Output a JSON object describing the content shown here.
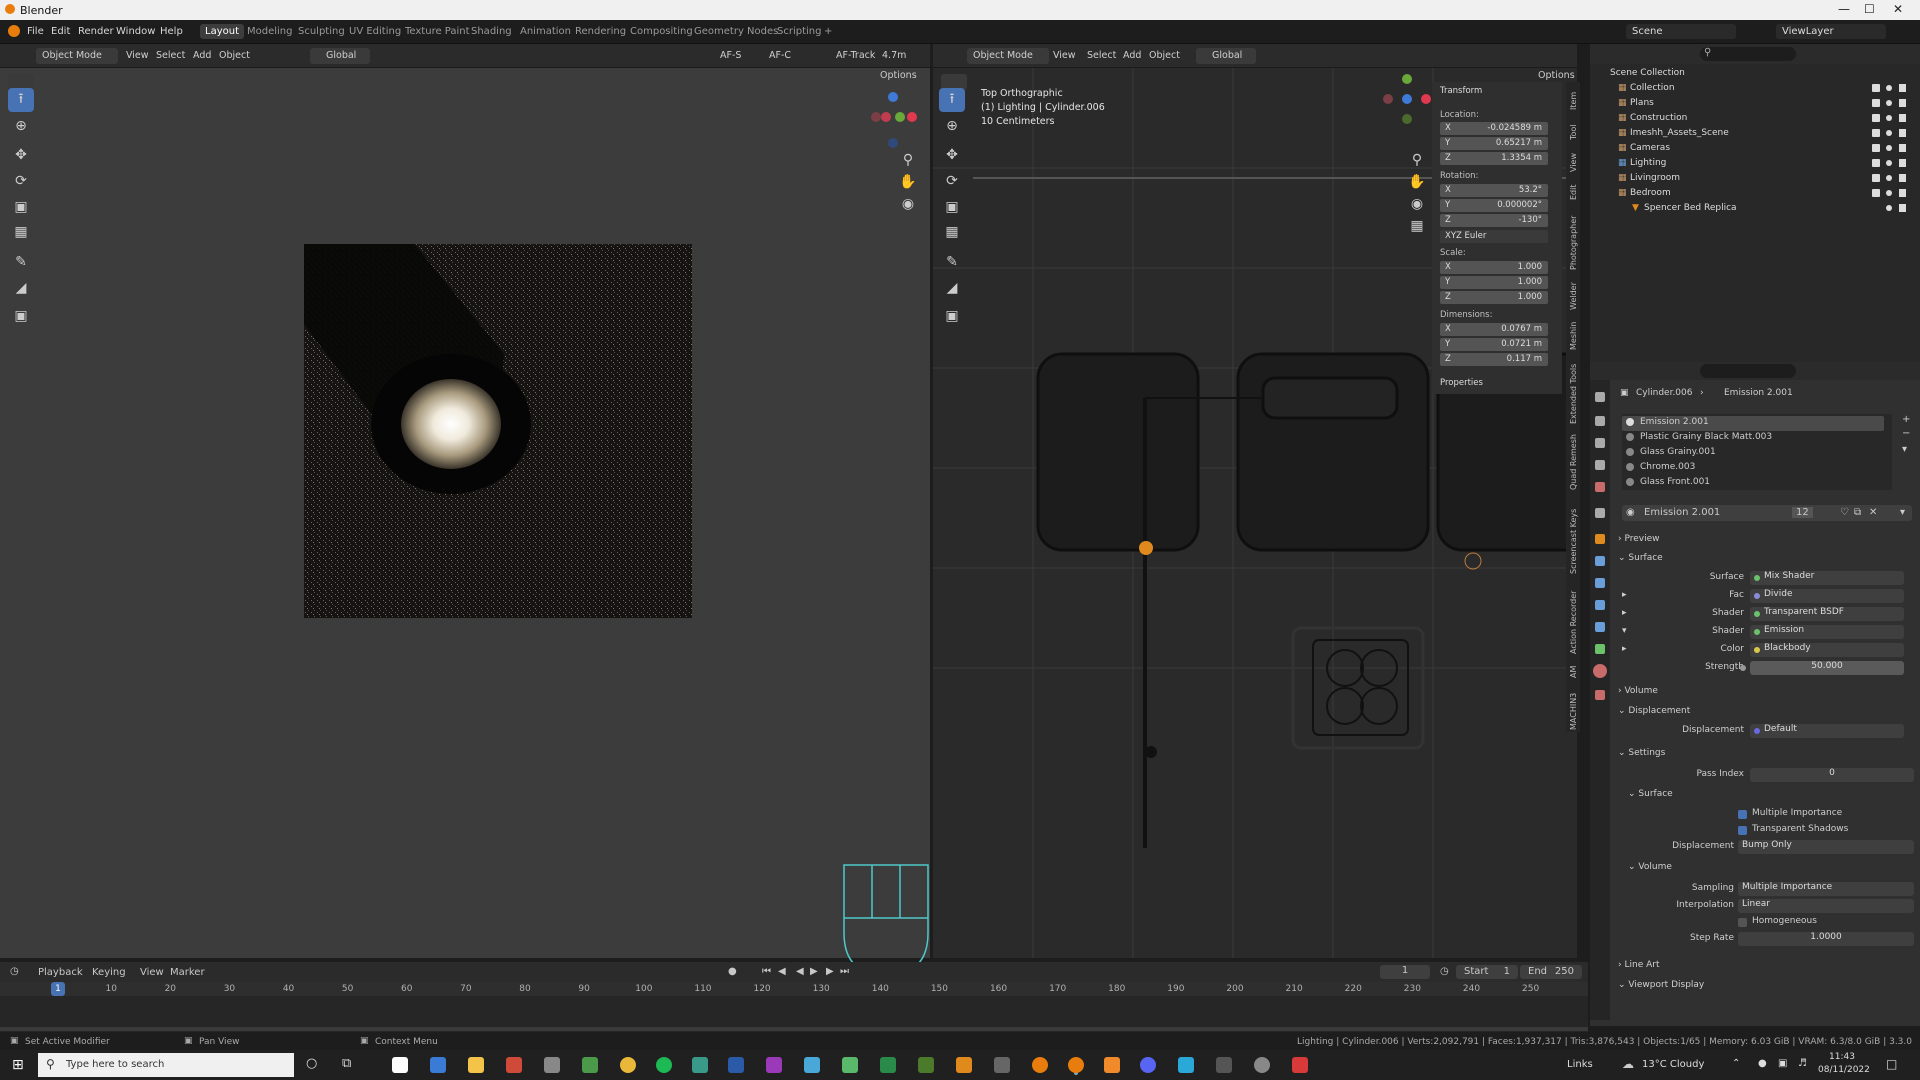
{
  "window": {
    "title": "Blender"
  },
  "menu": [
    "File",
    "Edit",
    "Render",
    "Window",
    "Help"
  ],
  "workspaces": [
    "Layout",
    "Modeling",
    "Sculpting",
    "UV Editing",
    "Texture Paint",
    "Shading",
    "Animation",
    "Rendering",
    "Compositing",
    "Geometry Nodes",
    "Scripting",
    "+"
  ],
  "scene": {
    "label": "Scene",
    "viewlayer": "ViewLayer"
  },
  "left_header": {
    "mode": "Object Mode",
    "items": [
      "View",
      "Select",
      "Add",
      "Object"
    ],
    "orientation": "Global",
    "af_s": "AF-S",
    "af_c": "AF-C",
    "af_track": "AF-Track",
    "focal": "4.7m",
    "options": "Options"
  },
  "right_header": {
    "mode": "Object Mode",
    "items": [
      "View",
      "Select",
      "Add",
      "Object"
    ],
    "orientation": "Global",
    "options": "Options"
  },
  "viewport_overlay": {
    "line1": "Top Orthographic",
    "line2": "(1) Lighting | Cylinder.006",
    "line3": "10 Centimeters"
  },
  "transform": {
    "title": "Transform",
    "location_label": "Location:",
    "location": {
      "x": "-0.024589 m",
      "y": "0.65217 m",
      "z": "1.3354 m"
    },
    "rotation_label": "Rotation:",
    "rotation": {
      "x": "53.2°",
      "y": "0.000002°",
      "z": "-130°"
    },
    "euler": "XYZ Euler",
    "scale_label": "Scale:",
    "scale": {
      "x": "1.000",
      "y": "1.000",
      "z": "1.000"
    },
    "dimensions_label": "Dimensions:",
    "dimensions": {
      "x": "0.0767 m",
      "y": "0.0721 m",
      "z": "0.117 m"
    },
    "properties": "Properties"
  },
  "npanel_tabs": [
    "Item",
    "Tool",
    "View",
    "Edit",
    "Photographer",
    "Welder",
    "Meshin",
    "Extended Tools",
    "Quad Remesh",
    "Screencast Keys",
    "Action Recorder",
    "AM",
    "MACHIN3"
  ],
  "outliner": {
    "root": "Scene Collection",
    "items": [
      {
        "name": "Collection",
        "indent": 1
      },
      {
        "name": "Plans",
        "indent": 1
      },
      {
        "name": "Construction",
        "indent": 1
      },
      {
        "name": "Imeshh_Assets_Scene",
        "indent": 1
      },
      {
        "name": "Cameras",
        "indent": 1
      },
      {
        "name": "Lighting",
        "indent": 1
      },
      {
        "name": "Livingroom",
        "indent": 1
      },
      {
        "name": "Bedroom",
        "indent": 1
      },
      {
        "name": "Spencer Bed Replica",
        "indent": 2
      }
    ]
  },
  "properties": {
    "breadcrumb_object": "Cylinder.006",
    "breadcrumb_material": "Emission 2.001",
    "material_slots": [
      "Emission 2.001",
      "Plastic Grainy Black Matt.003",
      "Glass Grainy.001",
      "Chrome.003",
      "Glass Front.001"
    ],
    "material_name": "Emission 2.001",
    "users": "12",
    "preview": "Preview",
    "surface_section": "Surface",
    "surface": {
      "label": "Surface",
      "value": "Mix Shader"
    },
    "fac": {
      "label": "Fac",
      "value": "Divide"
    },
    "shader1": {
      "label": "Shader",
      "value": "Transparent BSDF"
    },
    "shader2": {
      "label": "Shader",
      "value": "Emission"
    },
    "color": {
      "label": "Color",
      "value": "Blackbody"
    },
    "strength": {
      "label": "Strength",
      "value": "50.000"
    },
    "volume": "Volume",
    "displacement_section": "Displacement",
    "displacement": {
      "label": "Displacement",
      "value": "Default"
    },
    "settings": "Settings",
    "pass_index": {
      "label": "Pass Index",
      "value": "0"
    },
    "sub_surface": "Surface",
    "multiple_importance": "Multiple Importance",
    "transparent_shadows": "Transparent Shadows",
    "displacement_method": {
      "label": "Displacement",
      "value": "Bump Only"
    },
    "sub_volume": "Volume",
    "sampling": {
      "label": "Sampling",
      "value": "Multiple Importance"
    },
    "interpolation": {
      "label": "Interpolation",
      "value": "Linear"
    },
    "homogeneous": "Homogeneous",
    "step_rate": {
      "label": "Step Rate",
      "value": "1.0000"
    },
    "line_art": "Line Art",
    "viewport_display": "Viewport Display"
  },
  "timeline": {
    "menus": [
      "Playback",
      "Keying",
      "View",
      "Marker"
    ],
    "current_frame": "1",
    "start_label": "Start",
    "start": "1",
    "end_label": "End",
    "end": "250",
    "ticks": [
      "1",
      "10",
      "20",
      "30",
      "40",
      "50",
      "60",
      "70",
      "80",
      "90",
      "100",
      "110",
      "120",
      "130",
      "140",
      "150",
      "160",
      "170",
      "180",
      "190",
      "200",
      "210",
      "220",
      "230",
      "240",
      "250"
    ]
  },
  "status_bar": {
    "left1": "Set Active Modifier",
    "left2": "Pan View",
    "left3": "Context Menu",
    "right": "Lighting | Cylinder.006 | Verts:2,092,791 | Faces:1,937,317 | Tris:3,876,543 | Objects:1/65 | Memory: 6.03 GiB | VRAM: 6.3/8.0 GiB | 3.3.0"
  },
  "taskbar": {
    "search_placeholder": "Type here to search",
    "links": "Links",
    "weather": "13°C  Cloudy",
    "time": "11:43",
    "date": "08/11/2022"
  },
  "colors": {
    "accent": "#4772b3",
    "header": "#2b2b2b",
    "viewport_left": "#3c3c3c",
    "viewport_right": "#2a2a2a",
    "object_orange": "#e08a1e"
  }
}
